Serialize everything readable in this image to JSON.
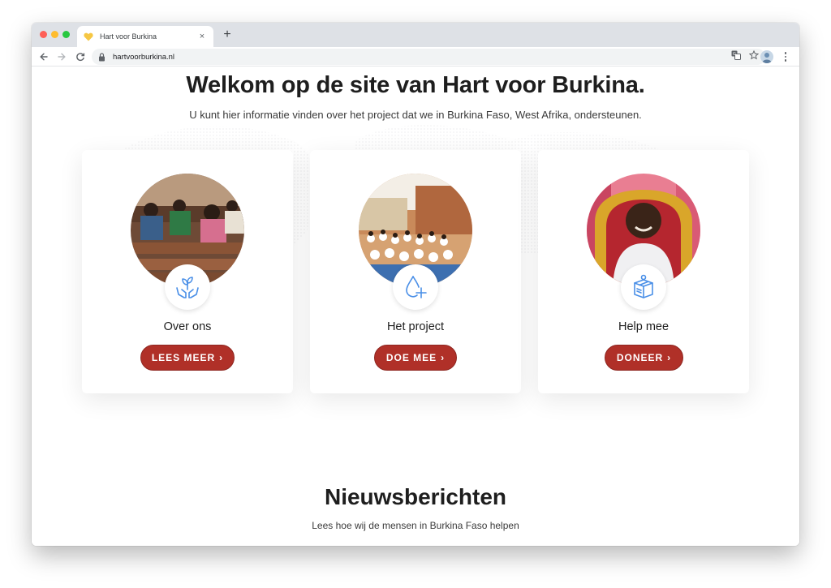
{
  "browser": {
    "tab_title": "Hart voor Burkina",
    "url": "hartvoorburkina.nl",
    "new_tab": "+",
    "tab_close": "×"
  },
  "hero": {
    "title": "Welkom op de site van Hart voor Burkina.",
    "subtitle": "U kunt hier informatie vinden over het project dat we in Burkina Faso, West Afrika, ondersteunen."
  },
  "cards": [
    {
      "title": "Over ons",
      "button": "LEES MEER",
      "icon": "hands-plant-icon"
    },
    {
      "title": "Het project",
      "button": "DOE MEE",
      "icon": "water-drop-plus-icon"
    },
    {
      "title": "Help mee",
      "button": "DONEER",
      "icon": "donation-box-icon"
    }
  ],
  "news": {
    "title": "Nieuwsberichten",
    "subtitle": "Lees hoe wij de mensen in Burkina Faso helpen"
  },
  "colors": {
    "accent": "#b03028",
    "icon_blue": "#4a8fe7",
    "text": "#1e1e1e"
  }
}
